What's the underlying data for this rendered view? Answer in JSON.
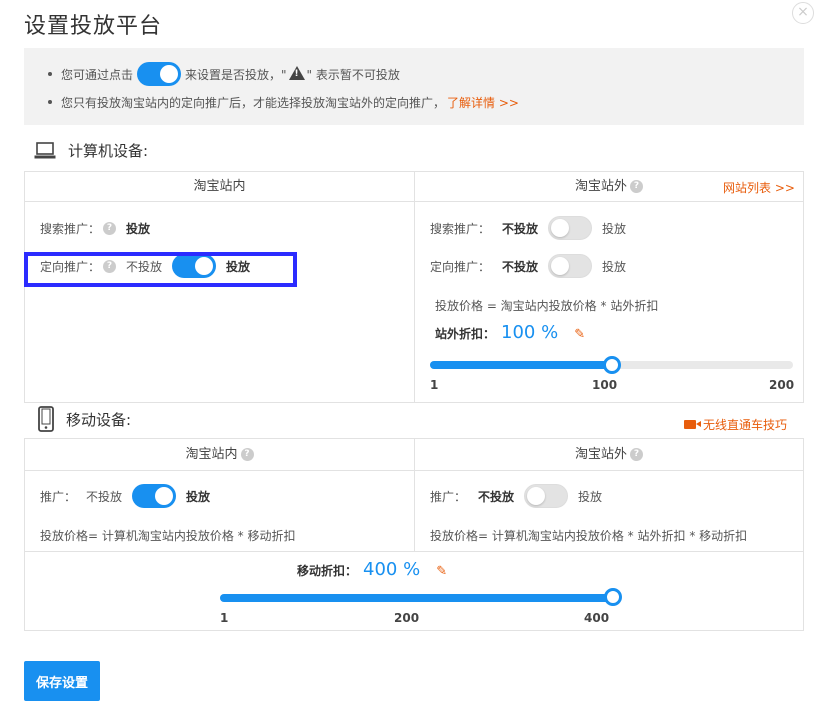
{
  "dialog": {
    "title": "设置投放平台",
    "close_glyph": "×"
  },
  "notice": {
    "line1_prefix": "您可通过点击",
    "line1_middle": "来设置是否投放，\"",
    "line1_suffix": "\" 表示暂不可投放",
    "line2": "您只有投放淘宝站内的定向推广后，才能选择投放淘宝站外的定向推广，",
    "line2_link": "了解详情 >>"
  },
  "pc": {
    "heading": "计算机设备:",
    "inside": {
      "header": "淘宝站内",
      "search_label": "搜索推广：",
      "search_value": "投放",
      "target_label": "定向推广：",
      "target_off": "不投放",
      "target_on": "投放"
    },
    "outside": {
      "header": "淘宝站外",
      "site_list_link": "网站列表 >>",
      "search_label": "搜索推广：",
      "search_off": "不投放",
      "search_on": "投放",
      "target_label": "定向推广：",
      "target_off": "不投放",
      "target_on": "投放",
      "price_note": "投放价格 = 淘宝站内投放价格 * 站外折扣",
      "discount_label": "站外折扣：",
      "discount_value": "100 %",
      "slider": {
        "min": "1",
        "mid": "100",
        "max": "200",
        "value": 100,
        "range": [
          1,
          200
        ]
      }
    }
  },
  "mobile": {
    "heading": "移动设备:",
    "video_link": "无线直通车技巧",
    "inside": {
      "header": "淘宝站内",
      "promo_label": "推广：",
      "promo_off": "不投放",
      "promo_on": "投放",
      "price_note": "投放价格= 计算机淘宝站内投放价格 * 移动折扣"
    },
    "outside": {
      "header": "淘宝站外",
      "promo_label": "推广：",
      "promo_off": "不投放",
      "promo_on": "投放",
      "price_note": "投放价格= 计算机淘宝站内投放价格 * 站外折扣 * 移动折扣"
    },
    "discount_label": "移动折扣：",
    "discount_value": "400 %",
    "slider": {
      "min": "1",
      "mid": "200",
      "max": "400",
      "value": 400,
      "range": [
        1,
        400
      ]
    }
  },
  "save_button": "保存设置",
  "colors": {
    "accent": "#1890f0",
    "link": "#e85d0c",
    "highlight": "#2b2bff"
  },
  "icons": [
    "close-icon",
    "warning-icon",
    "laptop-icon",
    "phone-icon",
    "help-icon",
    "edit-icon",
    "video-icon"
  ]
}
